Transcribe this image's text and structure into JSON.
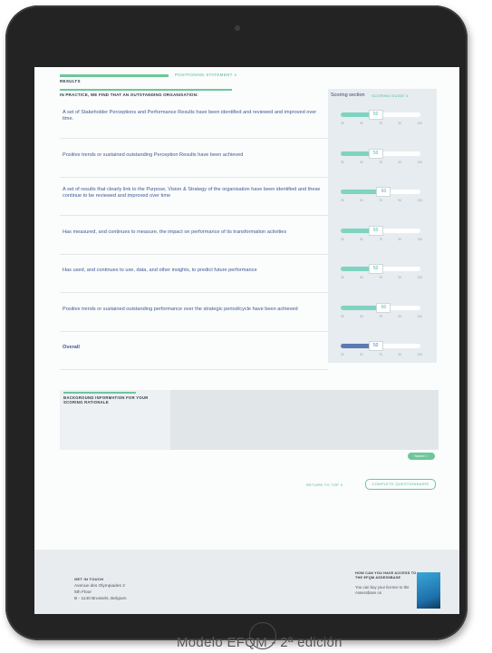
{
  "section": {
    "title": "RESULTS",
    "positioning_link": "POSITIONING STATEMENT ∨",
    "header": "IN PRACTICE, WE FIND THAT AN OUTSTANDING ORGANISATION:"
  },
  "scoring": {
    "label": "Scoring section",
    "link": "SCORING GUIDE ∨",
    "ticks": [
      "25",
      "50",
      "75",
      "90",
      "100"
    ]
  },
  "rows": [
    {
      "text": "A set of Stakeholder Perceptions and Performance Results have been identified and reviewed and improved over time.",
      "value": "50",
      "fraction": 0.36
    },
    {
      "text": "Positive trends or sustained outstanding Perception Results have been achieved",
      "value": "50",
      "fraction": 0.36
    },
    {
      "text": "A set of results that clearly link to the Purpose, Vision & Strategy of the organisation have been identified and these continue to be reviewed and improved over time",
      "value": "60",
      "fraction": 0.46
    },
    {
      "text": "Has measured, and continues to measure, the impact on performance of its transformation activities",
      "value": "50",
      "fraction": 0.36
    },
    {
      "text": "Has used, and continues to use, data, and other insights, to predict future performance",
      "value": "50",
      "fraction": 0.36
    },
    {
      "text": "Positive trends or sustained outstanding performance over the strategic period/cycle have been achieved",
      "value": "60",
      "fraction": 0.46
    },
    {
      "text": "Overall",
      "value": "50",
      "fraction": 0.36
    }
  ],
  "background": {
    "label": "BACKGROUND INFORMATION FOR YOUR SCORING RATIONALE",
    "value": ""
  },
  "saved_label": "Saved ✓",
  "return_label": "RETURN TO TOP ∧",
  "complete_label": "COMPLETE QUESTIONNAIRE",
  "footer": {
    "get_in_touch": "GET IN TOUCH",
    "address": [
      "Avenue des Olympiades 2",
      "5th Floor",
      "B - 1140 Brussels, Belgium"
    ],
    "how_title": "HOW CAN YOU HAVE ACCESS TO THE EFQM ASSESSBASE",
    "how_text": "You can buy your licence to the Assessbase on"
  },
  "caption": "Modelo EFQM - 2ª edición",
  "colors": {
    "accent": "#6cc79a",
    "slider_fill": "#7fd3c1",
    "overall_fill": "#5a7ab5",
    "link": "#4fb6a0",
    "row_text": "#3e5a92"
  }
}
